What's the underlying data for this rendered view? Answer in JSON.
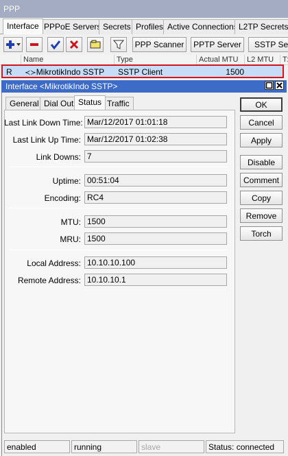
{
  "window": {
    "title": "PPP"
  },
  "tabs": [
    "Interface",
    "PPPoE Servers",
    "Secrets",
    "Profiles",
    "Active Connections",
    "L2TP Secrets"
  ],
  "toolbar": {
    "icons": [
      "add-icon",
      "remove-icon",
      "enable-check-icon",
      "disable-x-icon",
      "comment-icon",
      "filter-icon"
    ],
    "ppp_scanner": "PPP Scanner",
    "pptp_server": "PPTP Server",
    "sstp_server": "SSTP Server"
  },
  "list": {
    "columns": [
      "Name",
      "Type",
      "Actual MTU",
      "L2 MTU",
      "Tx"
    ],
    "rows": [
      {
        "flag": "R",
        "name": "MikrotikIndo SSTP",
        "type": "SSTP Client",
        "actual_mtu": "1500",
        "l2_mtu": ""
      }
    ]
  },
  "dialog": {
    "title": "Interface <MikrotikIndo SSTP>",
    "tabs": [
      "General",
      "Dial Out",
      "Status",
      "Traffic"
    ],
    "active_tab": "Status",
    "fields": {
      "last_link_down_time": {
        "label": "Last Link Down Time:",
        "value": "Mar/12/2017 01:01:18"
      },
      "last_link_up_time": {
        "label": "Last Link Up Time:",
        "value": "Mar/12/2017 01:02:38"
      },
      "link_downs": {
        "label": "Link Downs:",
        "value": "7"
      },
      "uptime": {
        "label": "Uptime:",
        "value": "00:51:04"
      },
      "encoding": {
        "label": "Encoding:",
        "value": "RC4"
      },
      "mtu": {
        "label": "MTU:",
        "value": "1500"
      },
      "mru": {
        "label": "MRU:",
        "value": "1500"
      },
      "local_address": {
        "label": "Local Address:",
        "value": "10.10.10.100"
      },
      "remote_address": {
        "label": "Remote Address:",
        "value": "10.10.10.1"
      }
    },
    "buttons": {
      "ok": "OK",
      "cancel": "Cancel",
      "apply": "Apply",
      "disable": "Disable",
      "comment": "Comment",
      "copy": "Copy",
      "remove": "Remove",
      "torch": "Torch"
    },
    "status_bar": {
      "enabled": "enabled",
      "running": "running",
      "slave": "slave",
      "status": "Status: connected"
    }
  }
}
